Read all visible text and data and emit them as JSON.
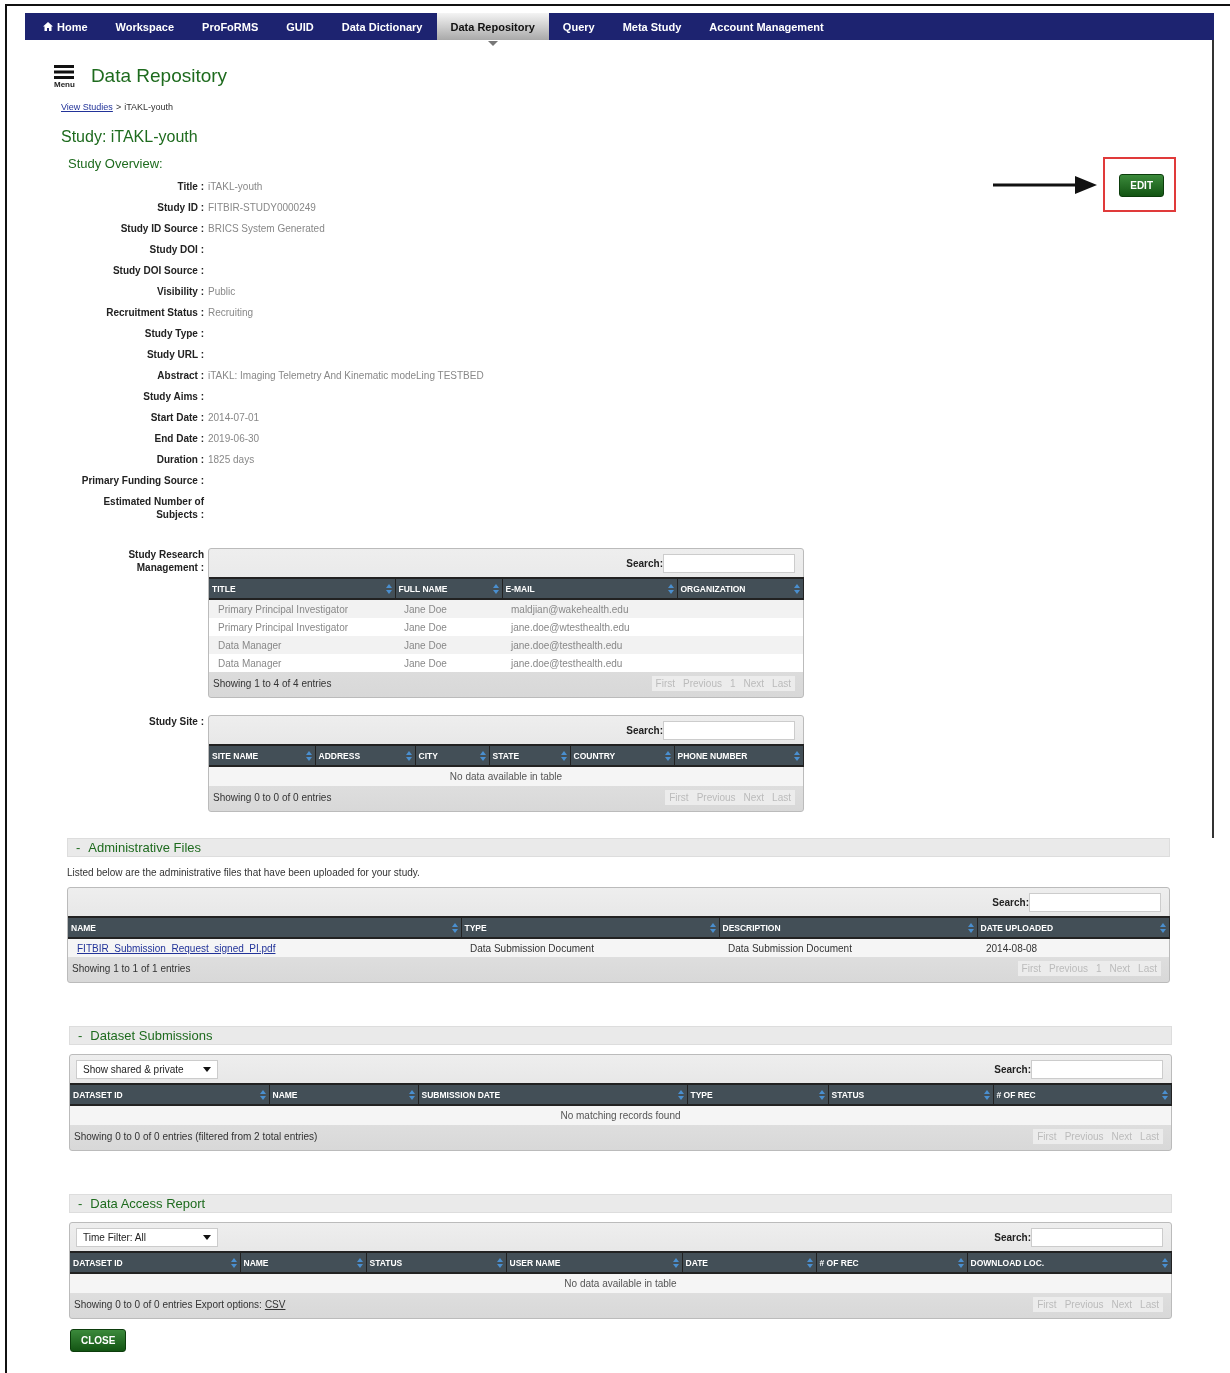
{
  "nav": {
    "items": [
      {
        "label": "Home",
        "kind": "home",
        "selected": false
      },
      {
        "label": "Workspace",
        "kind": "plain",
        "selected": false
      },
      {
        "label": "ProFoRMS",
        "kind": "plain",
        "selected": false
      },
      {
        "label": "GUID",
        "kind": "plain",
        "selected": false
      },
      {
        "label": "Data Dictionary",
        "kind": "plain",
        "selected": false
      },
      {
        "label": "Data Repository",
        "kind": "plain",
        "selected": true
      },
      {
        "label": "Query",
        "kind": "plain",
        "selected": false
      },
      {
        "label": "Meta Study",
        "kind": "plain",
        "selected": false
      },
      {
        "label": "Account Management",
        "kind": "plain",
        "selected": false
      }
    ]
  },
  "header": {
    "menu_label": "Menu",
    "title": "Data Repository"
  },
  "breadcrumb": {
    "link": "View Studies",
    "separator": ">",
    "current": "iTAKL-youth"
  },
  "study_heading": "Study: iTAKL-youth",
  "overview_heading": "Study Overview:",
  "edit_button": "EDIT",
  "fields": [
    {
      "label": "Title :",
      "value": "iTAKL-youth"
    },
    {
      "label": "Study ID :",
      "value": "FITBIR-STUDY0000249"
    },
    {
      "label": "Study ID Source :",
      "value": "BRICS System Generated"
    },
    {
      "label": "Study DOI :"
    },
    {
      "label": "Study DOI Source :"
    },
    {
      "label": "Visibility :",
      "value": "Public"
    },
    {
      "label": "Recruitment Status :",
      "value": "Recruiting"
    },
    {
      "label": "Study Type :"
    },
    {
      "label": "Study URL :"
    },
    {
      "label": "Abstract :",
      "value": "iTAKL: Imaging Telemetry And Kinematic modeLing TESTBED"
    },
    {
      "label": "Study Aims :"
    },
    {
      "label": "Start Date :",
      "value": "2014-07-01"
    },
    {
      "label": "End Date :",
      "value": "2019-06-30"
    },
    {
      "label": "Duration :",
      "value": "1825 days"
    },
    {
      "label": "Primary Funding Source :"
    },
    {
      "label": "Estimated Number of Subjects :"
    }
  ],
  "research_table": {
    "label": "Study Research Management :",
    "search_label": "Search:",
    "columns": [
      "TITLE",
      "FULL NAME",
      "E-MAIL",
      "ORGANIZATION"
    ],
    "rows": [
      [
        "Primary Principal Investigator",
        "Jane Doe",
        "maldjian@wakehealth.edu"
      ],
      [
        "Primary Principal Investigator",
        "Jane Doe",
        "jane.doe@wtesthealth.edu"
      ],
      [
        "Data Manager",
        "Jane Doe",
        "jane.doe@testhealth.edu"
      ],
      [
        "Data Manager",
        "Jane Doe",
        "jane.doe@testhealth.edu"
      ]
    ],
    "info": "Showing 1 to 4 of 4 entries",
    "pager": [
      "First",
      "Previous",
      "1",
      "Next",
      "Last"
    ]
  },
  "site_table": {
    "label": "Study Site :",
    "search_label": "Search:",
    "columns": [
      "SITE NAME",
      "ADDRESS",
      "CITY",
      "STATE",
      "COUNTRY",
      "PHONE NUMBER"
    ],
    "empty": "No data available in table",
    "info": "Showing 0 to 0 of 0 entries",
    "pager": [
      "First",
      "Previous",
      "Next",
      "Last"
    ]
  },
  "sections": [
    {
      "toggle": "-",
      "title": "Administrative Files",
      "description": "Listed below are the administrative files that have been uploaded for your study.",
      "table": {
        "search_label": "Search:",
        "columns": [
          "NAME",
          "TYPE",
          "DESCRIPTION",
          "DATE UPLOADED"
        ],
        "rows": [
          [
            {
              "text": "FITBIR_Submission_Request_signed_PI.pdf",
              "kind": "link"
            },
            "Data Submission Document",
            "Data Submission Document",
            "2014-08-08"
          ]
        ],
        "info": "Showing 1 to 1 of 1 entries",
        "pager": [
          "First",
          "Previous",
          "1",
          "Next",
          "Last"
        ]
      }
    },
    {
      "toggle": "-",
      "title": "Dataset Submissions",
      "table": {
        "filter": "Show shared & private",
        "search_label": "Search:",
        "columns": [
          "DATASET ID",
          "NAME",
          "SUBMISSION DATE",
          "TYPE",
          "STATUS",
          "# OF REC"
        ],
        "empty": "No matching records found",
        "info": "Showing 0 to 0 of 0 entries (filtered from 2 total entries)",
        "pager": [
          "First",
          "Previous",
          "Next",
          "Last"
        ]
      }
    },
    {
      "toggle": "-",
      "title": "Data Access Report",
      "table": {
        "filter": "Time Filter: All",
        "search_label": "Search:",
        "columns": [
          "DATASET ID",
          "NAME",
          "STATUS",
          "USER NAME",
          "DATE",
          "# OF REC",
          "DOWNLOAD LOC."
        ],
        "empty": "No data available in table",
        "info": "Showing 0 to 0 of 0 entries Export options:",
        "export_link": "CSV",
        "pager": [
          "First",
          "Previous",
          "Next",
          "Last"
        ]
      }
    }
  ],
  "close_button": "CLOSE"
}
